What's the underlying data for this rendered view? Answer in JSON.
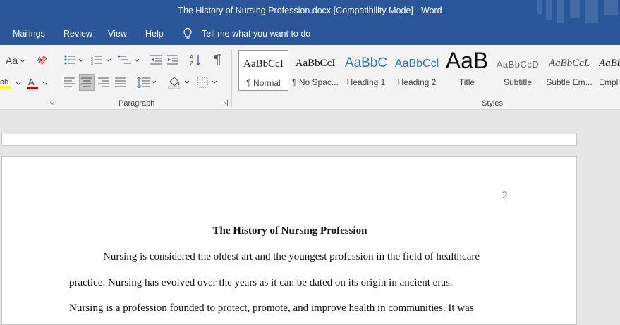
{
  "window": {
    "title": "The History of Nursing Profession.docx [Compatibility Mode]  -  Word"
  },
  "menu": {
    "items": [
      "Mailings",
      "Review",
      "View",
      "Help"
    ],
    "tell_me": "Tell me what you want to do"
  },
  "ribbon": {
    "font_case_label": "Aa",
    "paragraph_label": "Paragraph",
    "styles_label": "Styles",
    "styles": [
      {
        "preview": "AaBbCcI",
        "name": "¶ Normal"
      },
      {
        "preview": "AaBbCcI",
        "name": "¶ No Spac..."
      },
      {
        "preview": "AaBbC",
        "name": "Heading 1"
      },
      {
        "preview": "AaBbCcl",
        "name": "Heading 2"
      },
      {
        "preview": "AaB",
        "name": "Title"
      },
      {
        "preview": "AaBbCcD",
        "name": "Subtitle"
      },
      {
        "preview": "AaBbCcL",
        "name": "Subtle Em..."
      },
      {
        "preview": "AaBb",
        "name": "Empl"
      }
    ],
    "colors": {
      "highlight": "#ffff00",
      "font_color": "#d00000",
      "title_bar": "#2b579a"
    }
  },
  "document": {
    "page_number": "2",
    "title": "The History of Nursing Profession",
    "lines": [
      "Nursing is considered the oldest art and the youngest profession in the field of healthcare",
      "practice. Nursing has evolved over the years as it can be dated on its origin in ancient eras.",
      "Nursing is a profession founded to protect, promote, and improve health in communities. It was"
    ]
  }
}
